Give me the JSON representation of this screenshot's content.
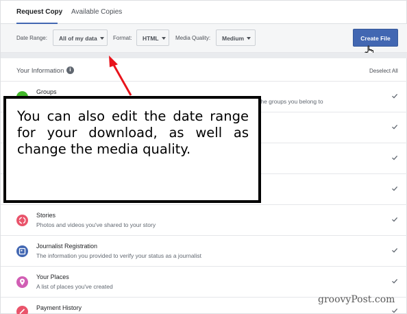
{
  "tabs": [
    {
      "label": "Request Copy",
      "active": true
    },
    {
      "label": "Available Copies",
      "active": false
    }
  ],
  "toolbar": {
    "date_range_label": "Date Range:",
    "date_range_value": "All of my data",
    "format_label": "Format:",
    "format_value": "HTML",
    "media_quality_label": "Media Quality:",
    "media_quality_value": "Medium",
    "create_button": "Create File"
  },
  "info": {
    "title": "Your Information",
    "info_icon": "i",
    "deselect": "Deselect All"
  },
  "rows": [
    {
      "title": "Groups",
      "desc": "the groups you belong to",
      "icon": "groups-icon",
      "color": "#42b72a"
    },
    {
      "title": "",
      "desc": "",
      "icon": "",
      "color": ""
    },
    {
      "title": "",
      "desc": "",
      "icon": "",
      "color": ""
    },
    {
      "title": "",
      "desc": "",
      "icon": "",
      "color": ""
    },
    {
      "title": "Stories",
      "desc": "Photos and videos you've shared to your story",
      "icon": "stories-icon",
      "color": "#e9546b"
    },
    {
      "title": "Journalist Registration",
      "desc": "The information you provided to verify your status as a journalist",
      "icon": "journalist-icon",
      "color": "#4267b2"
    },
    {
      "title": "Your Places",
      "desc": "A list of places you've created",
      "icon": "place-pin-icon",
      "color": "#d15eb4"
    },
    {
      "title": "Payment History",
      "desc": "",
      "icon": "payment-icon",
      "color": "#e9546b"
    }
  ],
  "callout": {
    "text": "You can also edit the date range for your download, as well as change the media quality."
  },
  "watermark": "groovyPost.com",
  "colors": {
    "accent": "#4267b2",
    "arrow": "#e8141c"
  }
}
